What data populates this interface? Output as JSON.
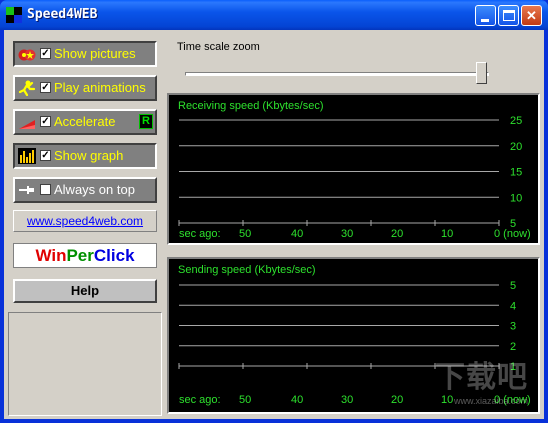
{
  "window": {
    "title": "Speed4WEB",
    "minimize": "_",
    "maximize": "□",
    "close": "✕"
  },
  "sidebar": {
    "buttons": [
      {
        "label": "Show pictures",
        "checked": true,
        "icon": "pictures-icon"
      },
      {
        "label": "Play animations",
        "checked": true,
        "icon": "animation-icon"
      },
      {
        "label": "Accelerate",
        "checked": true,
        "icon": "accelerate-icon",
        "badge": "R"
      },
      {
        "label": "Show graph",
        "checked": true,
        "icon": "graph-icon"
      },
      {
        "label": "Always on top",
        "checked": false,
        "icon": "pin-icon"
      }
    ],
    "check_mark": "✓",
    "website": "www.speed4web.com",
    "ad": {
      "win": "Win",
      "per": "Per",
      "click": "Click"
    },
    "help": "Help"
  },
  "zoom": {
    "label": "Time scale zoom",
    "level": 1.0
  },
  "colors": {
    "graph_text": "#2de02d",
    "grid": "#a8a8a8",
    "accent_yellow": "#ffff00"
  },
  "watermark": {
    "text": "下载吧",
    "url": "www.xiazaiba.com"
  },
  "chart_data": [
    {
      "type": "line",
      "title": "Receiving speed (Kbytes/sec)",
      "y_ticks": [
        "25",
        "20",
        "15",
        "10",
        "5"
      ],
      "ylim": [
        0,
        25
      ],
      "x_ticks": [
        "sec ago:",
        "50",
        "40",
        "30",
        "20",
        "10",
        "0 (now)"
      ],
      "xlim": [
        50,
        0
      ],
      "grid": true,
      "series": []
    },
    {
      "type": "line",
      "title": "Sending speed (Kbytes/sec)",
      "y_ticks": [
        "5",
        "4",
        "3",
        "2",
        "1"
      ],
      "ylim": [
        0,
        5
      ],
      "x_ticks": [
        "sec ago:",
        "50",
        "40",
        "30",
        "20",
        "10",
        "0 (now)"
      ],
      "xlim": [
        50,
        0
      ],
      "grid": true,
      "series": []
    }
  ]
}
